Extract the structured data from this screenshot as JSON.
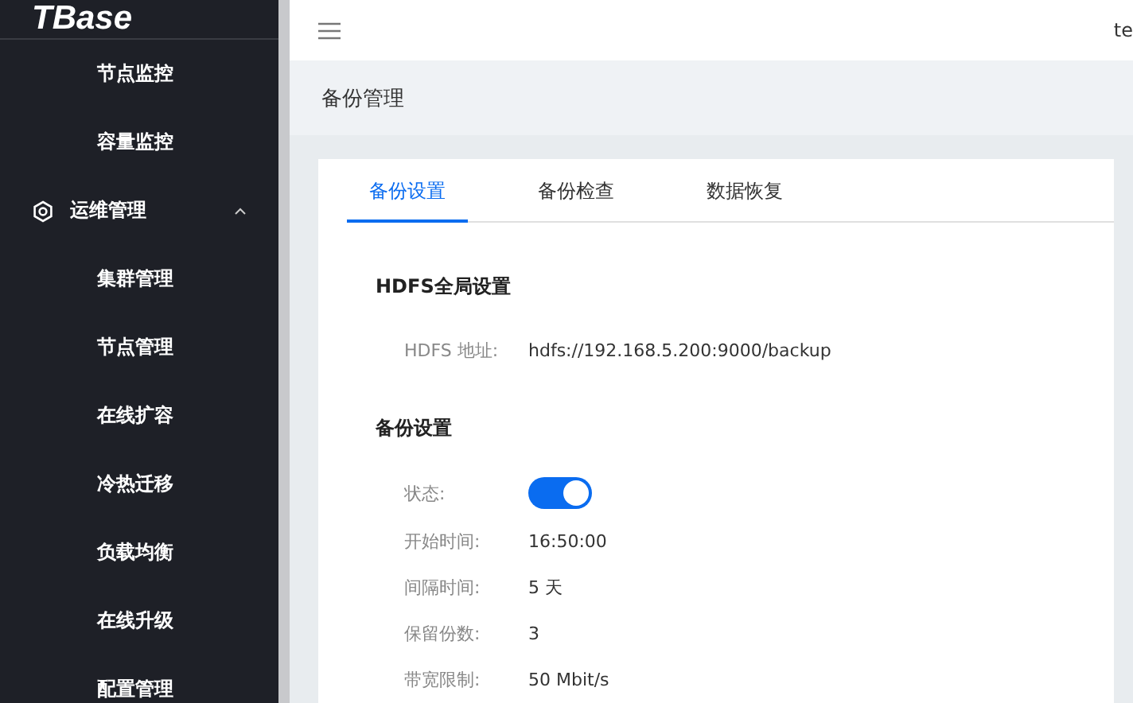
{
  "logo": "TBase",
  "sidebar": {
    "items": [
      {
        "label": "节点监控",
        "kind": "sub"
      },
      {
        "label": "容量监控",
        "kind": "sub"
      },
      {
        "label": "运维管理",
        "kind": "group",
        "expanded": true
      },
      {
        "label": "集群管理",
        "kind": "sub"
      },
      {
        "label": "节点管理",
        "kind": "sub"
      },
      {
        "label": "在线扩容",
        "kind": "sub"
      },
      {
        "label": "冷热迁移",
        "kind": "sub"
      },
      {
        "label": "负载均衡",
        "kind": "sub"
      },
      {
        "label": "在线升级",
        "kind": "sub"
      },
      {
        "label": "配置管理",
        "kind": "sub"
      }
    ]
  },
  "header": {
    "user": "te"
  },
  "page_title": "备份管理",
  "tabs": [
    {
      "label": "备份设置",
      "selected": true
    },
    {
      "label": "备份检查",
      "selected": false
    },
    {
      "label": "数据恢复",
      "selected": false
    }
  ],
  "sections": [
    {
      "title": "HDFS全局设置",
      "rows": [
        {
          "label": "HDFS 地址:",
          "kind": "text",
          "value": "hdfs://192.168.5.200:9000/backup"
        }
      ]
    },
    {
      "title": "备份设置",
      "rows": [
        {
          "label": "状态:",
          "kind": "switch",
          "on": true
        },
        {
          "label": "开始时间:",
          "kind": "text",
          "value": "16:50:00"
        },
        {
          "label": "间隔时间:",
          "kind": "text",
          "value": "5 天"
        },
        {
          "label": "保留份数:",
          "kind": "text",
          "value": "3"
        },
        {
          "label": "带宽限制:",
          "kind": "text",
          "value": "50 Mbit/s"
        }
      ]
    }
  ]
}
